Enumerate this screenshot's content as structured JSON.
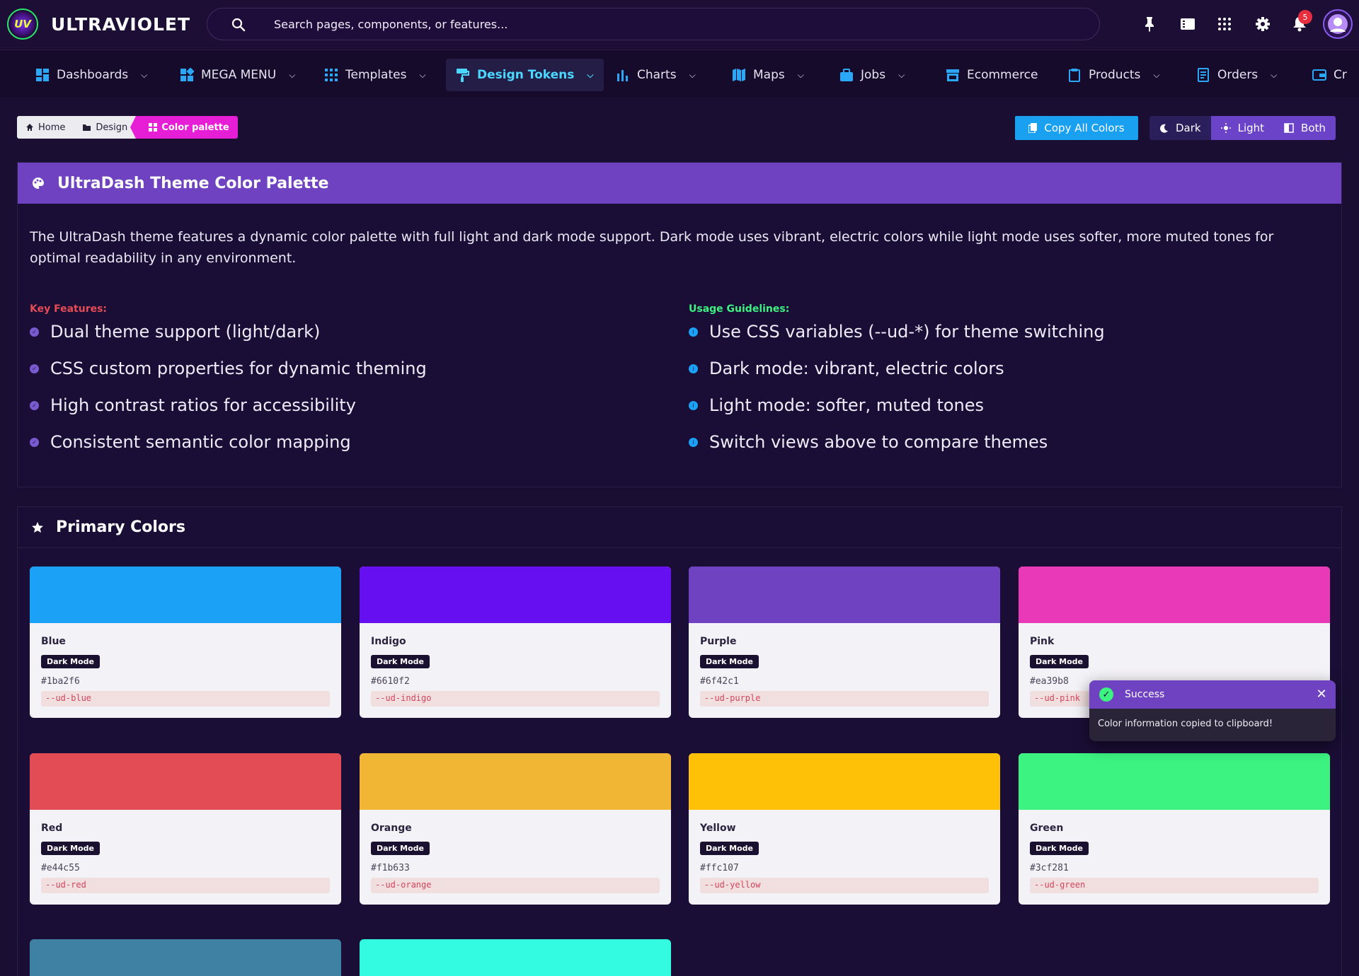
{
  "app": {
    "brand": "ULTRAVIOLET",
    "logo_text": "UV"
  },
  "search": {
    "placeholder": "Search pages, components, or features..."
  },
  "topbar": {
    "notification_count": "5"
  },
  "nav": {
    "items": [
      {
        "label": "Dashboards",
        "icon": "dashboard-icon",
        "dropdown": true
      },
      {
        "label": "MEGA MENU",
        "icon": "mega-menu-icon",
        "dropdown": true
      },
      {
        "label": "Templates",
        "icon": "grid-icon",
        "dropdown": true
      },
      {
        "label": "Design Tokens",
        "icon": "paint-roller-icon",
        "dropdown": true,
        "active": true
      },
      {
        "label": "Charts",
        "icon": "bar-chart-icon",
        "dropdown": true
      },
      {
        "label": "Maps",
        "icon": "map-icon",
        "dropdown": true
      },
      {
        "label": "Jobs",
        "icon": "briefcase-icon",
        "dropdown": true
      },
      {
        "label": "Ecommerce",
        "icon": "store-icon",
        "dropdown": false
      },
      {
        "label": "Products",
        "icon": "clipboard-icon",
        "dropdown": true
      },
      {
        "label": "Orders",
        "icon": "receipt-icon",
        "dropdown": true
      },
      {
        "label": "Cr",
        "icon": "wallet-icon",
        "dropdown": false
      }
    ]
  },
  "breadcrumb": {
    "home": "Home",
    "design": "Design",
    "current": "Color palette"
  },
  "toolbar": {
    "copy_all": "Copy All Colors",
    "dark": "Dark",
    "light": "Light",
    "both": "Both"
  },
  "intro": {
    "title": "UltraDash Theme Color Palette",
    "description": "The UltraDash theme features a dynamic color palette with full light and dark mode support. Dark mode uses vibrant, electric colors while light mode uses softer, more muted tones for optimal readability in any environment.",
    "features_title": "Key Features:",
    "features": [
      "Dual theme support (light/dark)",
      "CSS custom properties for dynamic theming",
      "High contrast ratios for accessibility",
      "Consistent semantic color mapping"
    ],
    "guidelines_title": "Usage Guidelines:",
    "guidelines": [
      "Use CSS variables (--ud-*) for theme switching",
      "Dark mode: vibrant, electric colors",
      "Light mode: softer, muted tones",
      "Switch views above to compare themes"
    ]
  },
  "primary": {
    "title": "Primary Colors",
    "mode_badge": "Dark Mode",
    "colors": [
      {
        "name": "Blue",
        "hex": "#1ba2f6",
        "var": "--ud-blue"
      },
      {
        "name": "Indigo",
        "hex": "#6610f2",
        "var": "--ud-indigo"
      },
      {
        "name": "Purple",
        "hex": "#6f42c1",
        "var": "--ud-purple"
      },
      {
        "name": "Pink",
        "hex": "#ea39b8",
        "var": "--ud-pink"
      },
      {
        "name": "Red",
        "hex": "#e44c55",
        "var": "--ud-red"
      },
      {
        "name": "Orange",
        "hex": "#f1b633",
        "var": "--ud-orange"
      },
      {
        "name": "Yellow",
        "hex": "#ffc107",
        "var": "--ud-yellow"
      },
      {
        "name": "Green",
        "hex": "#3cf281",
        "var": "--ud-green"
      },
      {
        "swatch": "#3f81a2"
      },
      {
        "swatch": "#32fbe2"
      }
    ]
  },
  "toast": {
    "title": "Success",
    "message": "Color information copied to clipboard!"
  },
  "colors": {
    "background": "#1a0f33",
    "accent": "#6f42c1",
    "active_nav": "#4bd7ff",
    "features_title": "#e44c55",
    "guidelines_title": "#3cf281",
    "crumb_active": "#e61fd6",
    "copy_button": "#1aa0f0"
  }
}
